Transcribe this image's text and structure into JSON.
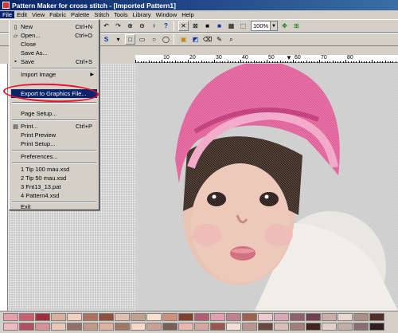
{
  "window": {
    "title": "Pattern Maker for cross stitch - [Imported Pattern1]"
  },
  "menubar": [
    "File",
    "Edit",
    "View",
    "Fabric",
    "Palette",
    "Stitch",
    "Tools",
    "Library",
    "Window",
    "Help"
  ],
  "toolbar": {
    "zoom": "100%",
    "zoom_dropdown": "▼"
  },
  "ruler": {
    "labels": [
      "10",
      "20",
      "30",
      "40",
      "50",
      "60",
      "70",
      "80"
    ],
    "marker": "▼"
  },
  "file_menu": {
    "items": [
      {
        "label": "New",
        "shortcut": "Ctrl+N"
      },
      {
        "label": "Open...",
        "shortcut": "Ctrl+O"
      },
      {
        "label": "Close",
        "shortcut": ""
      },
      {
        "label": "Save As...",
        "shortcut": ""
      },
      {
        "label": "Save",
        "shortcut": "Ctrl+S"
      },
      {
        "label": "Import Image",
        "shortcut": ""
      },
      {
        "label": "Export to Graphics File...",
        "shortcut": ""
      },
      {
        "label": "Page Setup...",
        "shortcut": ""
      },
      {
        "label": "Print...",
        "shortcut": "Ctrl+P"
      },
      {
        "label": "Print Preview",
        "shortcut": ""
      },
      {
        "label": "Print Setup...",
        "shortcut": ""
      },
      {
        "label": "Preferences...",
        "shortcut": ""
      },
      {
        "label": "1 Tip 100 mau.xsd",
        "shortcut": ""
      },
      {
        "label": "2 Tip 50 mau.xsd",
        "shortcut": ""
      },
      {
        "label": "3 Fnt13_13.pat",
        "shortcut": ""
      },
      {
        "label": "4 Pattern4.xsd",
        "shortcut": ""
      },
      {
        "label": "Exit",
        "shortcut": ""
      }
    ],
    "submenu_arrow": "▶"
  },
  "colors": {
    "title_bar": "#0a246a",
    "menu_highlight": "#0a246a",
    "annotation_ring": "#e8102a",
    "hat": "#e0609a",
    "skin": "#e8c0b0"
  },
  "palette": {
    "row1": [
      "#e8a0a8",
      "#c86070",
      "#a03040",
      "#d8b0a0",
      "#f0d0c0",
      "#b07060",
      "#905040",
      "#e0c0b0",
      "#c0a090",
      "#f8e0d0",
      "#d09080",
      "#804030",
      "#b06070",
      "#e0a0b0",
      "#c08090",
      "#a06050",
      "#f0c8d0",
      "#d8a8b8",
      "#906070",
      "#704050",
      "#c8b0a8",
      "#e8d8d0",
      "#a89088",
      "#503028"
    ],
    "row2": [
      "#f0b8c0",
      "#b05060",
      "#d89098",
      "#e8c8b8",
      "#907068",
      "#c09888",
      "#e0b0a0",
      "#a07868",
      "#f8d8c8",
      "#c8a098",
      "#786058",
      "#e8b8b0",
      "#d0a8a0",
      "#985850",
      "#f0e0d8",
      "#b89890",
      "#684840",
      "#d8c0b8",
      "#a08078",
      "#402820",
      "#e0d0c8",
      "#c0b0a8",
      "#887070",
      "#302020"
    ]
  }
}
